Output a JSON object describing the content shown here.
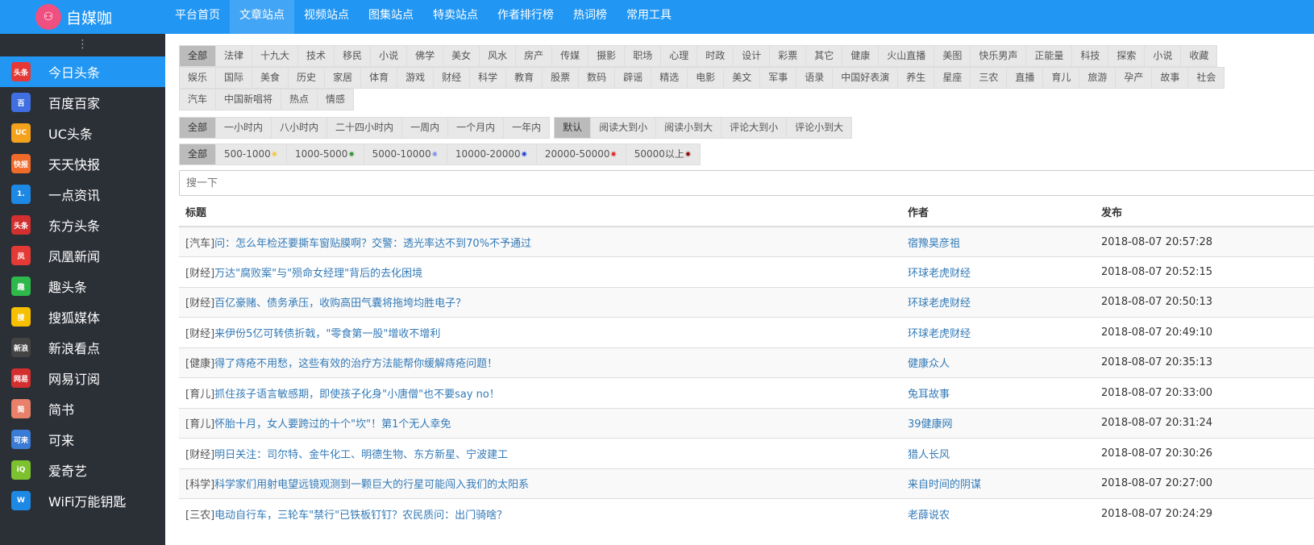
{
  "brand": "自媒咖",
  "nav": [
    "平台首页",
    "文章站点",
    "视频站点",
    "图集站点",
    "特卖站点",
    "作者排行榜",
    "热词榜",
    "常用工具"
  ],
  "nav_active": 1,
  "sidebar": [
    {
      "label": "今日头条",
      "icon": "头条",
      "color": "#e53935"
    },
    {
      "label": "百度百家",
      "icon": "百",
      "color": "#3f6fe0"
    },
    {
      "label": "UC头条",
      "icon": "UC",
      "color": "#f4a21c"
    },
    {
      "label": "天天快报",
      "icon": "快报",
      "color": "#f06a2a"
    },
    {
      "label": "一点资讯",
      "icon": "1.",
      "color": "#1e88e5"
    },
    {
      "label": "东方头条",
      "icon": "头条",
      "color": "#d32f2f"
    },
    {
      "label": "凤凰新闻",
      "icon": "凤",
      "color": "#e53935"
    },
    {
      "label": "趣头条",
      "icon": "趣",
      "color": "#2eb84b"
    },
    {
      "label": "搜狐媒体",
      "icon": "搜",
      "color": "#f6c000"
    },
    {
      "label": "新浪看点",
      "icon": "新浪",
      "color": "#444"
    },
    {
      "label": "网易订阅",
      "icon": "网易",
      "color": "#d32f2f"
    },
    {
      "label": "简书",
      "icon": "简",
      "color": "#e8806a"
    },
    {
      "label": "可来",
      "icon": "可来",
      "color": "#3a7bd5"
    },
    {
      "label": "爱奇艺",
      "icon": "iQ",
      "color": "#7cc12e"
    },
    {
      "label": "WiFi万能钥匙",
      "icon": "W",
      "color": "#1e88e5"
    }
  ],
  "categories_row1": [
    "全部",
    "法律",
    "十九大",
    "技术",
    "移民",
    "小说",
    "佛学",
    "美女",
    "风水",
    "房产",
    "传媒",
    "摄影",
    "职场",
    "心理",
    "时政",
    "设计",
    "彩票",
    "其它",
    "健康",
    "火山直播",
    "美图",
    "快乐男声",
    "正能量",
    "科技",
    "探索",
    "小说",
    "收藏"
  ],
  "categories_row2": [
    "娱乐",
    "国际",
    "美食",
    "历史",
    "家居",
    "体育",
    "游戏",
    "财经",
    "科学",
    "教育",
    "股票",
    "数码",
    "辟谣",
    "精选",
    "电影",
    "美文",
    "军事",
    "语录",
    "中国好表演",
    "养生",
    "星座",
    "三农",
    "直播",
    "育儿",
    "旅游",
    "孕产",
    "故事",
    "社会"
  ],
  "categories_row3": [
    "汽车",
    "中国新唱将",
    "热点",
    "情感"
  ],
  "time_filters": [
    "全部",
    "一小时内",
    "八小时内",
    "二十四小时内",
    "一周内",
    "一个月内",
    "一年内"
  ],
  "sort_filters": [
    "默认",
    "阅读大到小",
    "阅读小到大",
    "评论大到小",
    "评论小到大"
  ],
  "read_filters": [
    {
      "label": "全部",
      "star": ""
    },
    {
      "label": "500-1000",
      "star": "#f5c242"
    },
    {
      "label": "1000-5000",
      "star": "#2e8b2e"
    },
    {
      "label": "5000-10000",
      "star": "#7f8fe8"
    },
    {
      "label": "10000-20000",
      "star": "#1a3fd0"
    },
    {
      "label": "20000-50000",
      "star": "#e02020"
    },
    {
      "label": "50000以上",
      "star": "#8b0000"
    }
  ],
  "search_placeholder": "搜一下",
  "table": {
    "headers": [
      "标题",
      "作者",
      "发布"
    ],
    "rows": [
      {
        "tag": "[汽车]",
        "title": "问：怎么年检还要撕车窗贴膜啊？交警：透光率达不到70%不予通过",
        "author": "宿豫昊彦祖",
        "time": "2018-08-07 20:57:28"
      },
      {
        "tag": "[财经]",
        "title": "万达\"腐败案\"与\"殒命女经理\"背后的去化困境",
        "author": "环球老虎财经",
        "time": "2018-08-07 20:52:15"
      },
      {
        "tag": "[财经]",
        "title": "百亿豪赌、债务承压，收购高田气囊将拖垮均胜电子？",
        "author": "环球老虎财经",
        "time": "2018-08-07 20:50:13"
      },
      {
        "tag": "[财经]",
        "title": "来伊份5亿可转债折戟，\"零食第一股\"增收不增利",
        "author": "环球老虎财经",
        "time": "2018-08-07 20:49:10"
      },
      {
        "tag": "[健康]",
        "title": "得了痔疮不用愁，这些有效的治疗方法能帮你缓解痔疮问题！",
        "author": "健康众人",
        "time": "2018-08-07 20:35:13"
      },
      {
        "tag": "[育儿]",
        "title": "抓住孩子语言敏感期，即使孩子化身\"小唐僧\"也不要say no！",
        "author": "兔耳故事",
        "time": "2018-08-07 20:33:00"
      },
      {
        "tag": "[育儿]",
        "title": "怀胎十月，女人要跨过的十个\"坎\"！第1个无人幸免",
        "author": "39健康网",
        "time": "2018-08-07 20:31:24"
      },
      {
        "tag": "[财经]",
        "title": "明日关注：司尔特、金牛化工、明德生物、东方新星、宁波建工",
        "author": "猎人长风",
        "time": "2018-08-07 20:30:26"
      },
      {
        "tag": "[科学]",
        "title": "科学家们用射电望远镜观测到一颗巨大的行星可能闯入我们的太阳系",
        "author": "来自时间的阴谋",
        "time": "2018-08-07 20:27:00"
      },
      {
        "tag": "[三农]",
        "title": "电动自行车，三轮车\"禁行\"已铁板钉钉？农民质问：出门骑啥？",
        "author": "老薛说农",
        "time": "2018-08-07 20:24:29"
      }
    ]
  }
}
